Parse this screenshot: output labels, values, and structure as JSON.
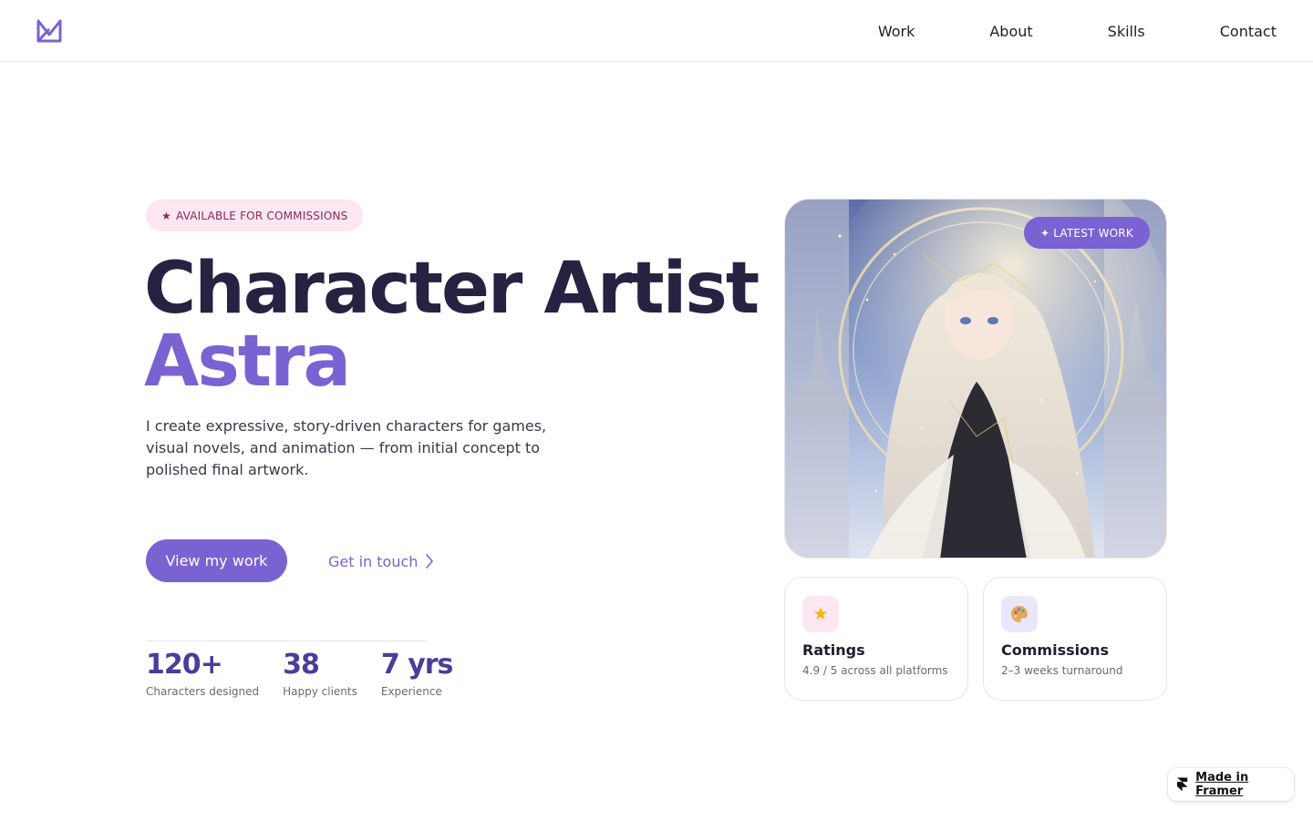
{
  "header": {
    "logo_icon": "monogram-logo-icon",
    "nav": [
      "Work",
      "About",
      "Skills",
      "Contact"
    ]
  },
  "hero": {
    "badge": "AVAILABLE FOR COMMISSIONS",
    "badge_icon": "star-icon",
    "title": "Character Artist",
    "name": "Astra",
    "description": "I create expressive, story-driven characters for games, visual novels, and animation — from initial concept to polished final artwork.",
    "primary_button": "View my work",
    "secondary_link": "Get in touch",
    "stats": [
      {
        "value": "120+",
        "label": "Characters designed"
      },
      {
        "value": "38",
        "label": "Happy clients"
      },
      {
        "value": "7 yrs",
        "label": "Experience"
      }
    ]
  },
  "showcase": {
    "badge": "LATEST WORK",
    "badge_icon": "sparkle-icon",
    "cards": [
      {
        "icon": "star-emoji-icon",
        "title": "Ratings",
        "subtitle": "4.9 / 5 across all platforms"
      },
      {
        "icon": "palette-emoji-icon",
        "title": "Commissions",
        "subtitle": "2–3 weeks turnaround"
      }
    ]
  },
  "framer_badge": "Made in Framer",
  "colors": {
    "accent": "#7b62d2",
    "heading": "#262242",
    "stat": "#4b3c9c",
    "badge_bg": "#fbe6f1"
  }
}
